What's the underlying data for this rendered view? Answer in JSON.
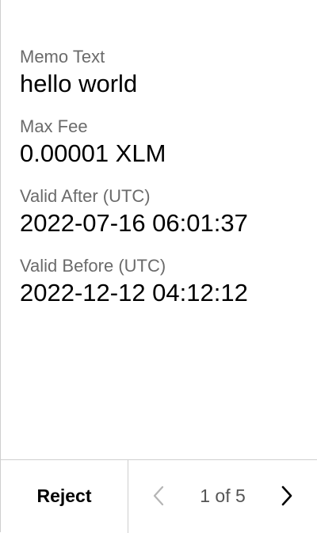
{
  "details": {
    "memo_text_label": "Memo Text",
    "memo_text_value": "hello world",
    "max_fee_label": "Max Fee",
    "max_fee_value": "0.00001 XLM",
    "valid_after_label": "Valid After (UTC)",
    "valid_after_value": "2022-07-16 06:01:37",
    "valid_before_label": "Valid Before (UTC)",
    "valid_before_value": "2022-12-12 04:12:12"
  },
  "footer": {
    "reject_label": "Reject",
    "page_indicator": "1 of 5",
    "prev_icon": "chevron-left-icon",
    "next_icon": "chevron-right-icon"
  },
  "colors": {
    "label_text": "#6b6b6b",
    "value_text": "#000000",
    "divider": "#cfcfcf",
    "disabled_icon": "#b5b5b5"
  }
}
